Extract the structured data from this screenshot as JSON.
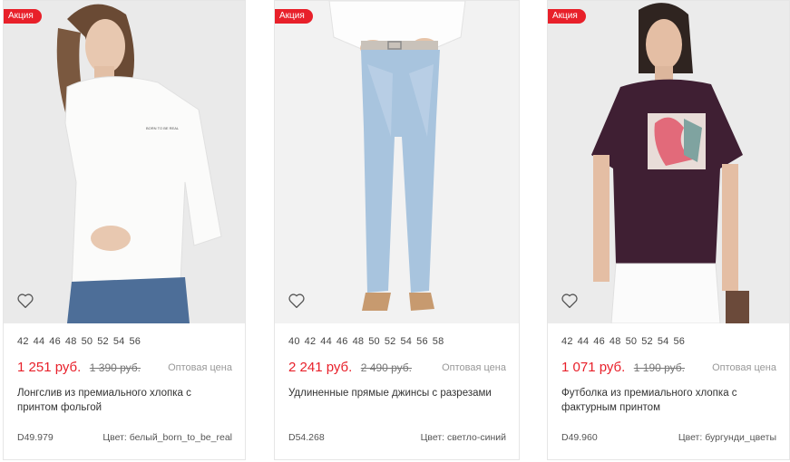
{
  "badge_label": "Акция",
  "wholesale_label": "Оптовая цена",
  "colors": {
    "accent": "#e8202a",
    "border": "#e6e6e6"
  },
  "products": [
    {
      "sizes": [
        "42",
        "44",
        "46",
        "48",
        "50",
        "52",
        "54",
        "56"
      ],
      "price": "1 251 руб.",
      "old_price": "1 390 руб.",
      "title": "Лонгслив из премиального хлопка с принтом фольгой",
      "sku": "D49.979",
      "color": "Цвет: белый_born_to_be_real"
    },
    {
      "sizes": [
        "40",
        "42",
        "44",
        "46",
        "48",
        "50",
        "52",
        "54",
        "56",
        "58"
      ],
      "price": "2 241 руб.",
      "old_price": "2 490 руб.",
      "title": "Удлиненные прямые джинсы с разрезами",
      "sku": "D54.268",
      "color": "Цвет: светло-синий"
    },
    {
      "sizes": [
        "42",
        "44",
        "46",
        "48",
        "50",
        "52",
        "54",
        "56"
      ],
      "price": "1 071 руб.",
      "old_price": "1 190 руб.",
      "title": "Футболка из премиального хлопка с фактурным принтом",
      "sku": "D49.960",
      "color": "Цвет: бургунди_цветы"
    }
  ]
}
